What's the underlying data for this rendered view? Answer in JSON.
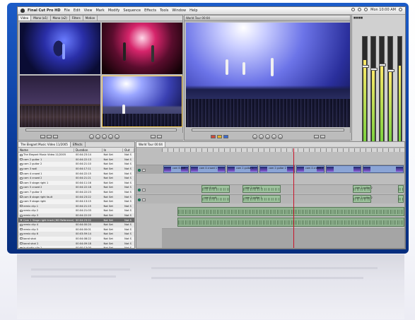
{
  "menubar": {
    "app_name": "Final Cut Pro HD",
    "items": [
      "File",
      "Edit",
      "View",
      "Mark",
      "Modify",
      "Sequence",
      "Effects",
      "Tools",
      "Window",
      "Help"
    ],
    "clock": "Mon 10:00 AM"
  },
  "viewer": {
    "tabs": [
      "Video",
      "Mono (a1)",
      "Mono (a2)",
      "Filters",
      "Motion"
    ]
  },
  "canvas": {
    "title": "World Tour 00:04"
  },
  "browser": {
    "tabs": [
      "The Elegant Music Video 11/2005",
      "Effects"
    ],
    "columns": [
      "Name",
      "Duration",
      "In",
      "Out"
    ],
    "rows": [
      {
        "name": "The Elegant Music Video 11/2005",
        "duration": "00:04:23:14",
        "in": "Not Set",
        "out": "Not S"
      },
      {
        "name": "cam 2 guitar 1",
        "duration": "00:04:22:13",
        "in": "Not Set",
        "out": "Not S"
      },
      {
        "name": "cam 2 guitar 2",
        "duration": "00:04:21:10",
        "in": "Not Set",
        "out": "Not S"
      },
      {
        "name": "cam 3 wall",
        "duration": "00:04:17:11",
        "in": "Not Set",
        "out": "Not S"
      },
      {
        "name": "cam 4 crowd 1",
        "duration": "00:04:22:15",
        "in": "Not Set",
        "out": "Not S"
      },
      {
        "name": "cam 4 crowd 2",
        "duration": "00:04:21:21",
        "in": "Not Set",
        "out": "Not S"
      },
      {
        "name": "cam 5 stage right 1",
        "duration": "00:04:11:16",
        "in": "Not Set",
        "out": "Not S"
      },
      {
        "name": "cam 5 crowd 2",
        "duration": "00:04:22:18",
        "in": "Not Set",
        "out": "Not S"
      },
      {
        "name": "cam 7 guitar 3",
        "duration": "00:04:22:23",
        "in": "Not Set",
        "out": "Not S"
      },
      {
        "name": "cam 8 stage right fault",
        "duration": "00:04:23:22",
        "in": "Not Set",
        "out": "Not S"
      },
      {
        "name": "cam 9 stage right",
        "duration": "00:04:13:15",
        "in": "Not Set",
        "out": "Not S"
      },
      {
        "name": "remix clip 1",
        "duration": "00:04:21:15",
        "in": "Not Set",
        "out": "Not S"
      },
      {
        "name": "remix clip 2",
        "duration": "00:04:21:03",
        "in": "Not Set",
        "out": "Not S"
      },
      {
        "name": "remix clip 3",
        "duration": "00:04:22:20",
        "in": "Not Set",
        "out": "Not S"
      },
      {
        "name": "Cam 1 Stage right track (HD Reference)",
        "duration": "00:04:23:22",
        "in": "Not Set",
        "out": "Not S"
      },
      {
        "name": "remix clip 4",
        "duration": "00:04:00:20",
        "in": "Not Set",
        "out": "Not S"
      },
      {
        "name": "remix clip 5",
        "duration": "00:04:00:01",
        "in": "Not Set",
        "out": "Not S"
      },
      {
        "name": "remix clip 6",
        "duration": "00:03:59:14",
        "in": "Not Set",
        "out": "Not S"
      },
      {
        "name": "band shot",
        "duration": "00:04:08:22",
        "in": "Not Set",
        "out": "Not S"
      },
      {
        "name": "band shot 2",
        "duration": "00:04:09:18",
        "in": "Not Set",
        "out": "Not S"
      },
      {
        "name": "in studio clip 1",
        "duration": "00:00:13:00",
        "in": "Not Set",
        "out": "Not S"
      },
      {
        "name": "in studio clip 2",
        "duration": "00:00:09:21",
        "in": "Not Set",
        "out": "Not S"
      },
      {
        "name": "bad take clip",
        "duration": "00:00:07:06",
        "in": "Not Set",
        "out": "Not S"
      },
      {
        "name": "backstage clip 1",
        "duration": "00:00:11:08",
        "in": "Not Set",
        "out": "Not S"
      },
      {
        "name": "backstage clip 2",
        "duration": "00:00:12:11",
        "in": "Not Set",
        "out": "Not S"
      },
      {
        "name": "tour bus clip",
        "duration": "00:00:11:22",
        "in": "Not Set",
        "out": "Not S"
      }
    ],
    "selected_index": 14
  },
  "timeline": {
    "tab": "World Tour 00:04",
    "v1_clip_labels": [
      "cam 6 guit",
      "cam 4 crowd 1",
      "cam 2 guitar 1",
      "cam 2 guitar 2",
      "cam 4 crowd 2"
    ],
    "a_clip_labels": [
      "cam 6 guit",
      "cam 2 guitar 1",
      "cam 2 guitar 2"
    ]
  },
  "colors": {
    "frame_blue": "#0a3a98",
    "playhead": "#c8142a",
    "audio_clip": "#9ec39e",
    "video_clip": "#8ba5d6"
  }
}
